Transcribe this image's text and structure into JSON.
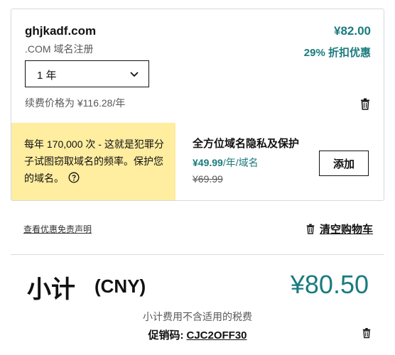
{
  "item": {
    "domain": "ghjkadf.com",
    "type": ".COM 域名注册",
    "price": "¥82.00",
    "discount": "29% 折扣优惠",
    "term": "1 年",
    "renewal": "续费价格为 ¥116.28/年",
    "delete_icon": "trash-icon"
  },
  "privacy": {
    "promo_text": "每年 170,000 次 - 这就是犯罪分子试图窃取域名的频率。保护您的域名。",
    "title": "全方位域名隐私及保护",
    "price": "¥49.99",
    "price_unit": "/年/域名",
    "old_price": "¥69.99",
    "add_label": "添加"
  },
  "links": {
    "disclaimer": "查看优惠免责声明",
    "empty_cart": "清空购物车"
  },
  "summary": {
    "subtotal_label": "小计",
    "currency": "(CNY)",
    "amount": "¥80.50",
    "tax_note": "小计费用不含适用的税费",
    "promo_label": "促销码:",
    "promo_code": "CJC2OFF30"
  },
  "colors": {
    "accent": "#1a7b7e",
    "promo_bg": "#ffeda0",
    "border": "#d4dbe0"
  }
}
